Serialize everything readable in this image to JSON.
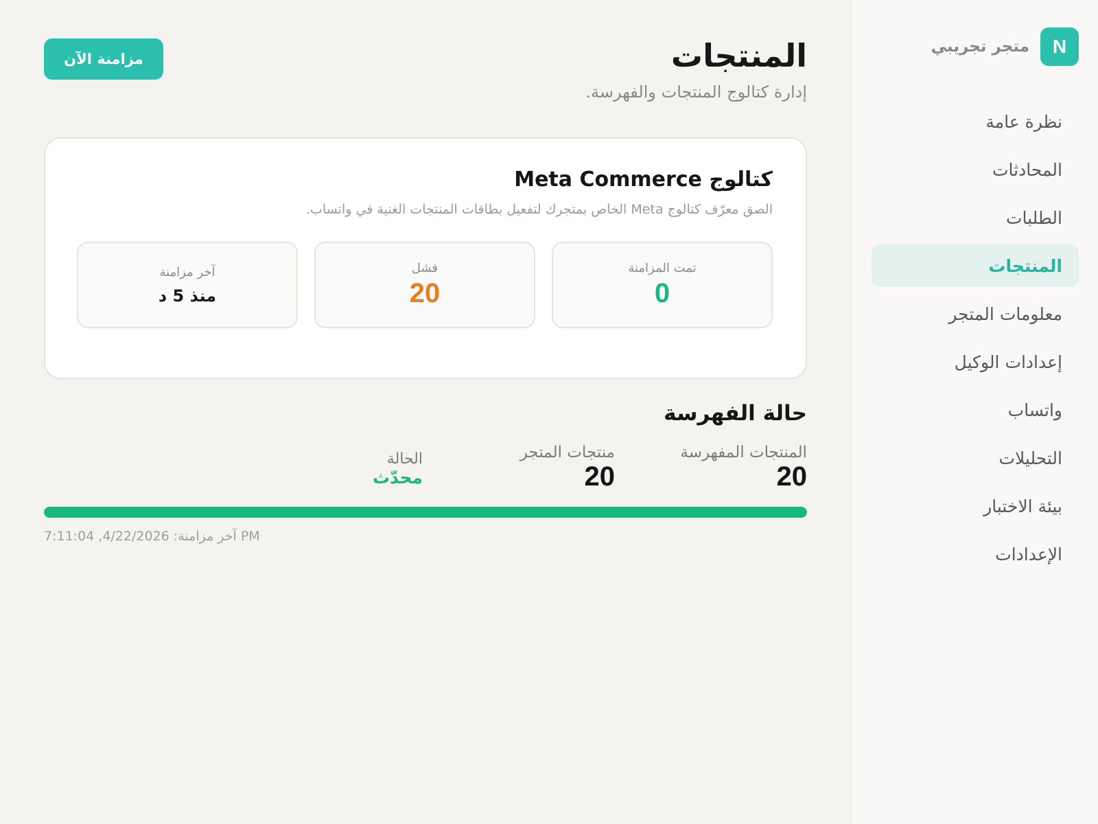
{
  "sidebar": {
    "brand_initial": "N",
    "brand_name": "متجر تجريبي",
    "items": [
      {
        "label": "نظرة عامة",
        "active": false
      },
      {
        "label": "المحادثات",
        "active": false
      },
      {
        "label": "الطلبات",
        "active": false
      },
      {
        "label": "المنتجات",
        "active": true
      },
      {
        "label": "معلومات المتجر",
        "active": false
      },
      {
        "label": "إعدادات الوكيل",
        "active": false
      },
      {
        "label": "واتساب",
        "active": false
      },
      {
        "label": "التحليلات",
        "active": false
      },
      {
        "label": "بيئة الاختبار",
        "active": false
      },
      {
        "label": "الإعدادات",
        "active": false
      }
    ]
  },
  "header": {
    "title": "المنتجات",
    "subtitle": "إدارة كتالوج المنتجات والفهرسة.",
    "sync_button": "مزامنة الآن"
  },
  "catalog": {
    "title": "كتالوج Meta Commerce",
    "description": "الصق معرّف كتالوج Meta الخاص بمتجرك لتفعيل بطاقات المنتجات الغنية في واتساب.",
    "stats": [
      {
        "label": "تمت المزامنة",
        "value": "0"
      },
      {
        "label": "فشل",
        "value": "20"
      },
      {
        "label": "آخر مزامنة",
        "value": "منذ 5 د"
      }
    ]
  },
  "indexing": {
    "title": "حالة الفهرسة",
    "indexed_label": "المنتجات المفهرسة",
    "indexed_value": "20",
    "store_label": "منتجات المتجر",
    "store_value": "20",
    "status_label": "الحالة",
    "status_value": "محدّث",
    "progress_percent": 100,
    "last_sync": "آخر مزامنة: 4/22/2026, 7:11:04 PM"
  },
  "colors": {
    "accent": "#2bbfae",
    "success": "#19b883",
    "warning": "#e67e22"
  }
}
